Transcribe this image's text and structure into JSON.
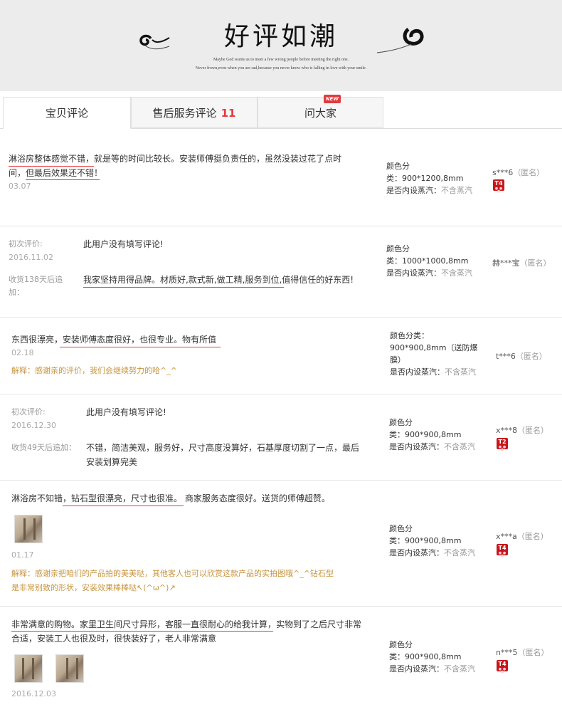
{
  "banner": {
    "title": "好评如潮",
    "sub1": "Maybe God wants us to meet a few wrong people before meeting the right one.",
    "sub2": "Never frown,even when you are sad,because you never know who is falling in love with your smile."
  },
  "tabs": [
    {
      "label": "宝贝评论"
    },
    {
      "label": "售后服务评论",
      "count": "11"
    },
    {
      "label": "问大家",
      "badge": "NEW"
    }
  ],
  "reviews": [
    {
      "text1": "淋浴房整体感觉不错，就是等的时间比较长。安装师傅挺负责任的，虽然没装过花了点时",
      "text2": "间，但最后效果还不错！",
      "date": "03.07",
      "sku1": "颜色分",
      "sku2": "类：900*1200,8mm",
      "sku3_label": "是否内设蒸汽：",
      "sku3_value": "不含蒸汽",
      "user": "s***6",
      "anon": "（匿名）",
      "level": "T4"
    },
    {
      "first_label": "初次评价:",
      "first_text": "此用户没有填写评论!",
      "date": "2016.11.02",
      "append_label1": "收货138天后追",
      "append_label2": "加：",
      "append_text": "我家坚持用得品牌。材质好,款式新,做工精,服务到位,值得信任的好东西!",
      "sku1": "颜色分",
      "sku2": "类：1000*1000,8mm",
      "sku3_label": "是否内设蒸汽：",
      "sku3_value": "不含蒸汽",
      "user": "赫***宝",
      "anon": "（匿名）"
    },
    {
      "text1": "东西很漂亮，安装师傅态度很好，也很专业。物有所值",
      "date": "02.18",
      "reply": "解释：感谢亲的评价，我们会继续努力的哈^_^",
      "sku1": "颜色分类：",
      "sku2": "900*900,8mm（送防爆",
      "sku3": "膜）",
      "sku4_label": "是否内设蒸汽：",
      "sku4_value": "不含蒸汽",
      "user": "t***6",
      "anon": "（匿名）"
    },
    {
      "first_label": "初次评价:",
      "first_text": "此用户没有填写评论!",
      "date": "2016.12.30",
      "append_label": "收货49天后追加：",
      "append_text1": "不错，简洁美观，服务好，尺寸高度没算好，石基厚度切割了一点，最后",
      "append_text2": "安装划算完美",
      "sku1": "颜色分",
      "sku2": "类：900*900,8mm",
      "sku3_label": "是否内设蒸汽：",
      "sku3_value": "不含蒸汽",
      "user": "x***8",
      "anon": "（匿名）",
      "level": "T2"
    },
    {
      "text1": "淋浴房不知错，钻石型很漂亮，尺寸也很准。 商家服务态度很好。送货的师傅超赞。",
      "date": "01.17",
      "reply1": "解释：感谢亲把咱们的产品拍的美美哒，其他客人也可以欣赏这款产品的实拍图哦^_^钻石型",
      "reply2": "是非常别致的形状，安装效果棒棒哒↖(^ω^)↗",
      "sku1": "颜色分",
      "sku2": "类：900*900,8mm",
      "sku3_label": "是否内设蒸汽：",
      "sku3_value": "不含蒸汽",
      "user": "x***a",
      "anon": "（匿名）",
      "level": "T4"
    },
    {
      "text1": "非常满意的购物。家里卫生间尺寸异形，客服一直很耐心的给我计算，实物到了之后尺寸非常",
      "text2": "合适，安装工人也很及时，很快装好了，老人非常满意",
      "date": "2016.12.03",
      "sku1": "颜色分",
      "sku2": "类：900*900,8mm",
      "sku3_label": "是否内设蒸汽：",
      "sku3_value": "不含蒸汽",
      "user": "n***5",
      "anon": "（匿名）",
      "level": "T4"
    }
  ],
  "colors": {
    "accent": "#e4393c",
    "reply": "#c7943f",
    "muted": "#aaaaaa",
    "level_badge": "#c8161d"
  },
  "icons": [
    "swirl-left-icon",
    "swirl-right-icon",
    "photo-thumbnail",
    "level-badge-icon"
  ]
}
